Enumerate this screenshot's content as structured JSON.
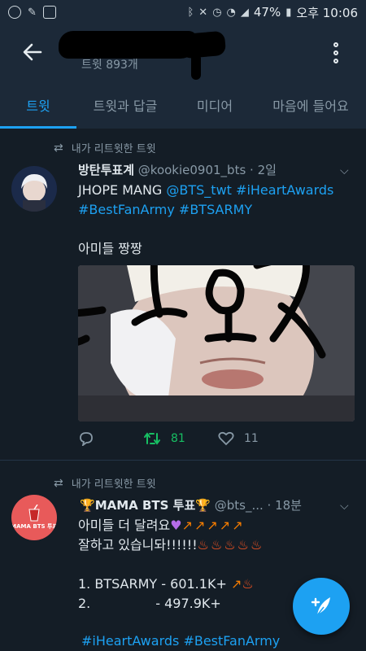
{
  "status_bar": {
    "battery": "47%",
    "time": "오후 10:06"
  },
  "header": {
    "tweet_count": "트윗 893개"
  },
  "tabs": [
    "트윗",
    "트윗과 답글",
    "미디어",
    "마음에 들어요"
  ],
  "tweets": [
    {
      "retweet_label": "내가 리트윗한 트윗",
      "name": "방탄투표계",
      "handle": "@kookie0901_bts · 2일",
      "text_plain": "JHOPE MANG ",
      "mention": "@BTS_twt",
      "hashtag1": "#iHeartAwards",
      "hashtag2": "#BestFanArmy",
      "hashtag3": "#BTSARMY",
      "subtext": "아미들 짱짱",
      "retweets": "81",
      "likes": "11"
    },
    {
      "retweet_label": "내가 리트윗한 트윗",
      "name": "MAMA BTS 투표",
      "handle": "@bts_... · 18분",
      "avatar_text": "MAMA BTS 투표",
      "line1": "아미들 더 달려요",
      "line2": "잘하고 있습니돠!!!!!!",
      "rank1": "1. BTSARMY - 601.1K+",
      "rank2_num": "2.",
      "rank2_val": "- 497.9K+",
      "hashtags": "#iHeartAwards #BestFanArmy"
    }
  ],
  "colors": {
    "accent": "#1da1f2",
    "retweet_green": "#17bf63",
    "background": "#141d26",
    "bar": "#1c2938"
  }
}
